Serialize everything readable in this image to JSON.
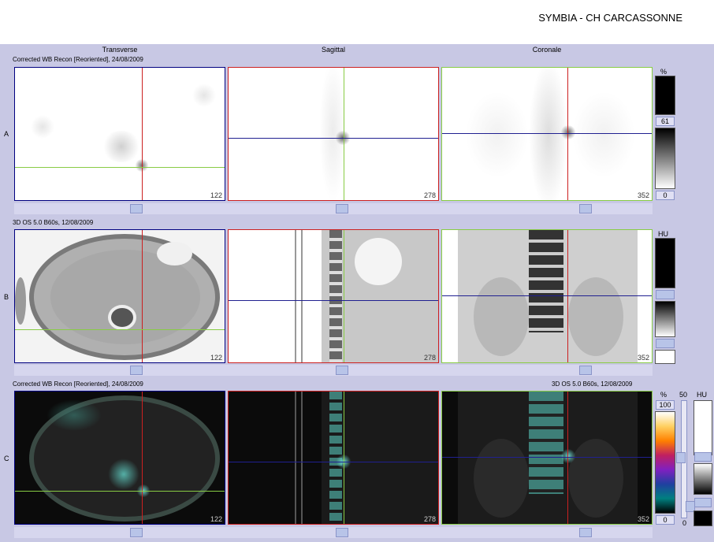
{
  "app": {
    "title": "SYMBIA - CH CARCASSONNE"
  },
  "columns": {
    "transverse": "Transverse",
    "sagittal": "Sagittal",
    "coronal": "Coronale"
  },
  "rows": {
    "a": {
      "letter": "A",
      "info": "Corrected WB Recon [Reoriented], 24/08/2009"
    },
    "b": {
      "letter": "B",
      "info": "3D  OS  5.0  B60s, 12/08/2009"
    },
    "c": {
      "letter": "C",
      "info_left": "Corrected WB Recon [Reoriented], 24/08/2009",
      "info_right": "3D  OS  5.0  B60s, 12/08/2009"
    }
  },
  "slices": {
    "transverse": "122",
    "sagittal": "278",
    "coronal": "352"
  },
  "scales": {
    "pet_unit": "%",
    "pet_max": "61",
    "pet_min": "0",
    "ct_unit": "HU",
    "fused_unit": "%",
    "fused_max": "100",
    "fused_min": "0",
    "fused_ct_unit": "HU",
    "fused_mid": "50",
    "fused_ct_min": "0"
  },
  "colors": {
    "workspace": "#c8c8e4",
    "crosshair_red": "#cc2020",
    "crosshair_green": "#88cc44",
    "crosshair_blue": "#202090"
  }
}
